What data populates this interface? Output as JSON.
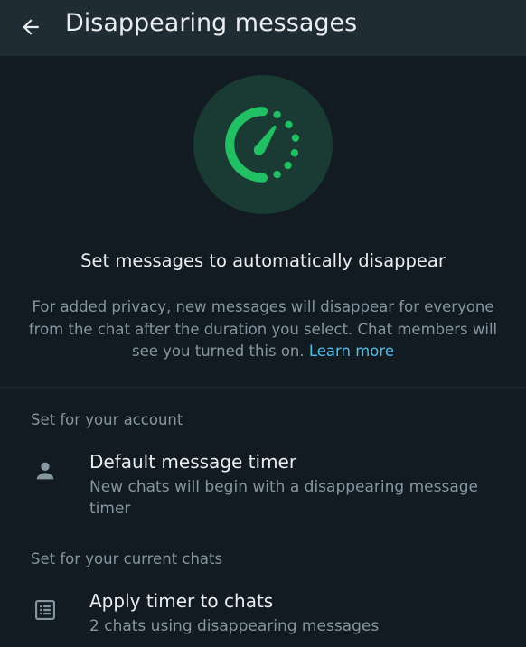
{
  "appbar": {
    "title": "Disappearing messages",
    "back_icon": "arrow-left-icon"
  },
  "hero": {
    "icon": "disappearing-timer-icon",
    "accent_color": "#21c063",
    "circle_color": "#1a3b33"
  },
  "intro": {
    "headline": "Set messages to automatically disappear",
    "description": "For added privacy, new messages will disappear for everyone from the chat after the duration you select. Chat members will see you turned this on.",
    "learn_more": "Learn more"
  },
  "account_section": {
    "header": "Set for your account",
    "item": {
      "icon": "person-icon",
      "title": "Default message timer",
      "subtitle": "New chats will begin with a disappearing message timer"
    }
  },
  "chats_section": {
    "header": "Set for your current chats",
    "item": {
      "icon": "chat-list-icon",
      "title": "Apply timer to chats",
      "subtitle": "2 chats using disappearing messages"
    }
  },
  "colors": {
    "background": "#111b21",
    "appbar": "#1f2c34",
    "primary_text": "#e9edef",
    "secondary_text": "#8696a0",
    "link": "#53bdeb"
  }
}
